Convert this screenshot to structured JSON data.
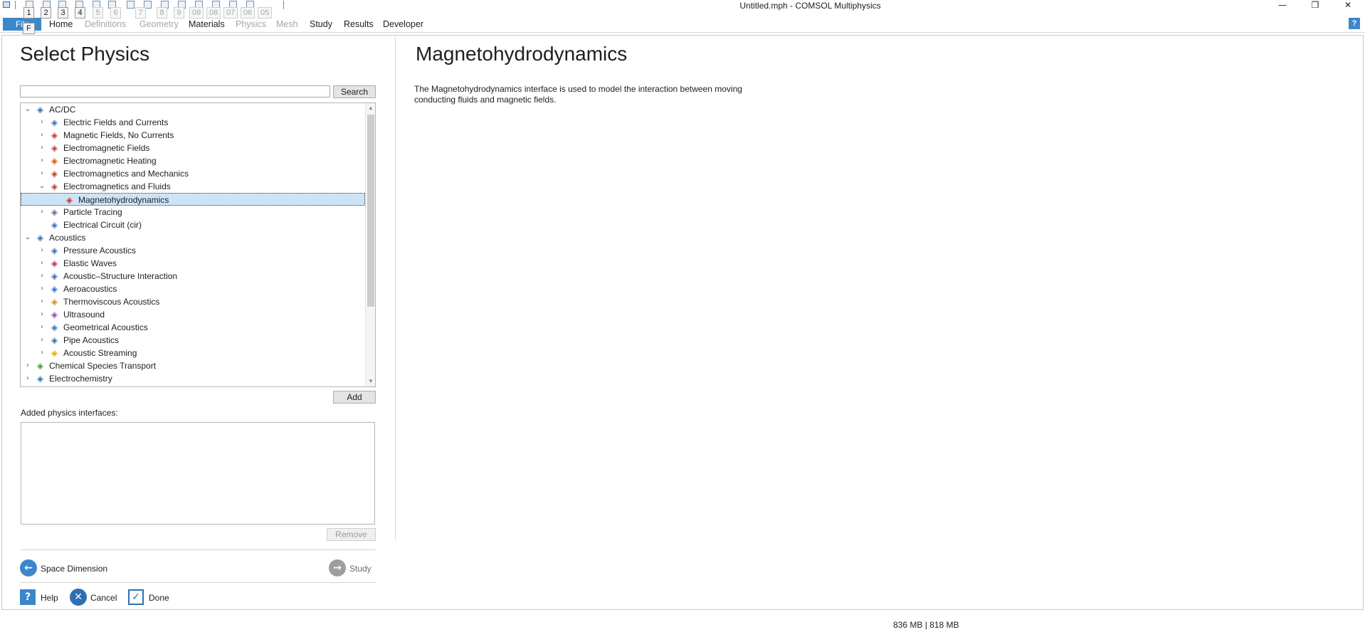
{
  "window": {
    "title": "Untitled.mph - COMSOL Multiphysics",
    "minimize_glyph": "—",
    "restore_glyph": "❐",
    "close_glyph": "✕"
  },
  "quick_access": {
    "keytips": [
      "1",
      "2",
      "3",
      "4",
      "5",
      "6",
      "7",
      "8",
      "9",
      "09",
      "08",
      "07",
      "06",
      "05"
    ]
  },
  "ribbon": {
    "file_label": "File",
    "file_keytip": "F",
    "tabs": [
      {
        "label": "Home",
        "enabled": true
      },
      {
        "label": "Definitions",
        "enabled": false
      },
      {
        "label": "Geometry",
        "enabled": false
      },
      {
        "label": "Materials",
        "enabled": true
      },
      {
        "label": "Physics",
        "enabled": false
      },
      {
        "label": "Mesh",
        "enabled": false
      },
      {
        "label": "Study",
        "enabled": true
      },
      {
        "label": "Results",
        "enabled": true
      },
      {
        "label": "Developer",
        "enabled": true
      }
    ],
    "help_label": "?"
  },
  "select_physics": {
    "title": "Select Physics",
    "search_value": "",
    "search_button": "Search",
    "tree": [
      {
        "label": "AC/DC",
        "level": 0,
        "expanded": true,
        "icon": "acdc-icon",
        "color": "#2b6fc1"
      },
      {
        "label": "Electric Fields and Currents",
        "level": 1,
        "expanded": false,
        "icon": "electric-fields-icon",
        "color": "#2b6fc1"
      },
      {
        "label": "Magnetic Fields, No Currents",
        "level": 1,
        "expanded": false,
        "icon": "magnetic-no-currents-icon",
        "color": "#c0392b"
      },
      {
        "label": "Electromagnetic Fields",
        "level": 1,
        "expanded": false,
        "icon": "electromagnetic-fields-icon",
        "color": "#c0392b"
      },
      {
        "label": "Electromagnetic Heating",
        "level": 1,
        "expanded": false,
        "icon": "electromagnetic-heating-icon",
        "color": "#d35400"
      },
      {
        "label": "Electromagnetics and Mechanics",
        "level": 1,
        "expanded": false,
        "icon": "electromagnetics-mechanics-icon",
        "color": "#c0392b"
      },
      {
        "label": "Electromagnetics and Fluids",
        "level": 1,
        "expanded": true,
        "icon": "electromagnetics-fluids-icon",
        "color": "#c0392b"
      },
      {
        "label": "Magnetohydrodynamics",
        "level": 2,
        "leaf": true,
        "selected": true,
        "icon": "magnetohydrodynamics-icon",
        "color": "#c0392b"
      },
      {
        "label": "Particle Tracing",
        "level": 1,
        "expanded": false,
        "icon": "particle-tracing-icon",
        "color": "#7d5ba6"
      },
      {
        "label": "Electrical Circuit (cir)",
        "level": 1,
        "leaf": true,
        "icon": "electrical-circuit-icon",
        "color": "#2b6fc1"
      },
      {
        "label": "Acoustics",
        "level": 0,
        "expanded": true,
        "icon": "acoustics-icon",
        "color": "#2b6fc1"
      },
      {
        "label": "Pressure Acoustics",
        "level": 1,
        "expanded": false,
        "icon": "pressure-acoustics-icon",
        "color": "#2b6fc1"
      },
      {
        "label": "Elastic Waves",
        "level": 1,
        "expanded": false,
        "icon": "elastic-waves-icon",
        "color": "#b0306a"
      },
      {
        "label": "Acoustic–Structure Interaction",
        "level": 1,
        "expanded": false,
        "icon": "acoustic-structure-icon",
        "color": "#2b6fc1"
      },
      {
        "label": "Aeroacoustics",
        "level": 1,
        "expanded": false,
        "icon": "aeroacoustics-icon",
        "color": "#2b6fc1"
      },
      {
        "label": "Thermoviscous Acoustics",
        "level": 1,
        "expanded": false,
        "icon": "thermoviscous-acoustics-icon",
        "color": "#e08a00"
      },
      {
        "label": "Ultrasound",
        "level": 1,
        "expanded": false,
        "icon": "ultrasound-icon",
        "color": "#9b3fb5"
      },
      {
        "label": "Geometrical Acoustics",
        "level": 1,
        "expanded": false,
        "icon": "geometrical-acoustics-icon",
        "color": "#2b6fc1"
      },
      {
        "label": "Pipe Acoustics",
        "level": 1,
        "expanded": false,
        "icon": "pipe-acoustics-icon",
        "color": "#2b6fc1"
      },
      {
        "label": "Acoustic Streaming",
        "level": 1,
        "expanded": false,
        "icon": "acoustic-streaming-icon",
        "color": "#e0a800"
      },
      {
        "label": "Chemical Species Transport",
        "level": 0,
        "expanded": false,
        "icon": "chemical-species-icon",
        "color": "#3a9a3a"
      },
      {
        "label": "Electrochemistry",
        "level": 0,
        "expanded": false,
        "icon": "electrochemistry-icon",
        "color": "#2b6fc1"
      }
    ],
    "add_button": "Add",
    "added_label": "Added physics interfaces:",
    "remove_button": "Remove",
    "back_label": "Space Dimension",
    "next_label": "Study",
    "help_label": "Help",
    "cancel_label": "Cancel",
    "done_label": "Done"
  },
  "description": {
    "title": "Magnetohydrodynamics",
    "text_line1": "The Magnetohydrodynamics interface is used to model the interaction between moving",
    "text_line2": "conducting fluids and magnetic fields."
  },
  "status": {
    "memory": "836 MB | 818 MB"
  },
  "colors": {
    "accent": "#3c87cc",
    "selection": "#cce4f7",
    "disabled_text": "#a6a6a6"
  }
}
